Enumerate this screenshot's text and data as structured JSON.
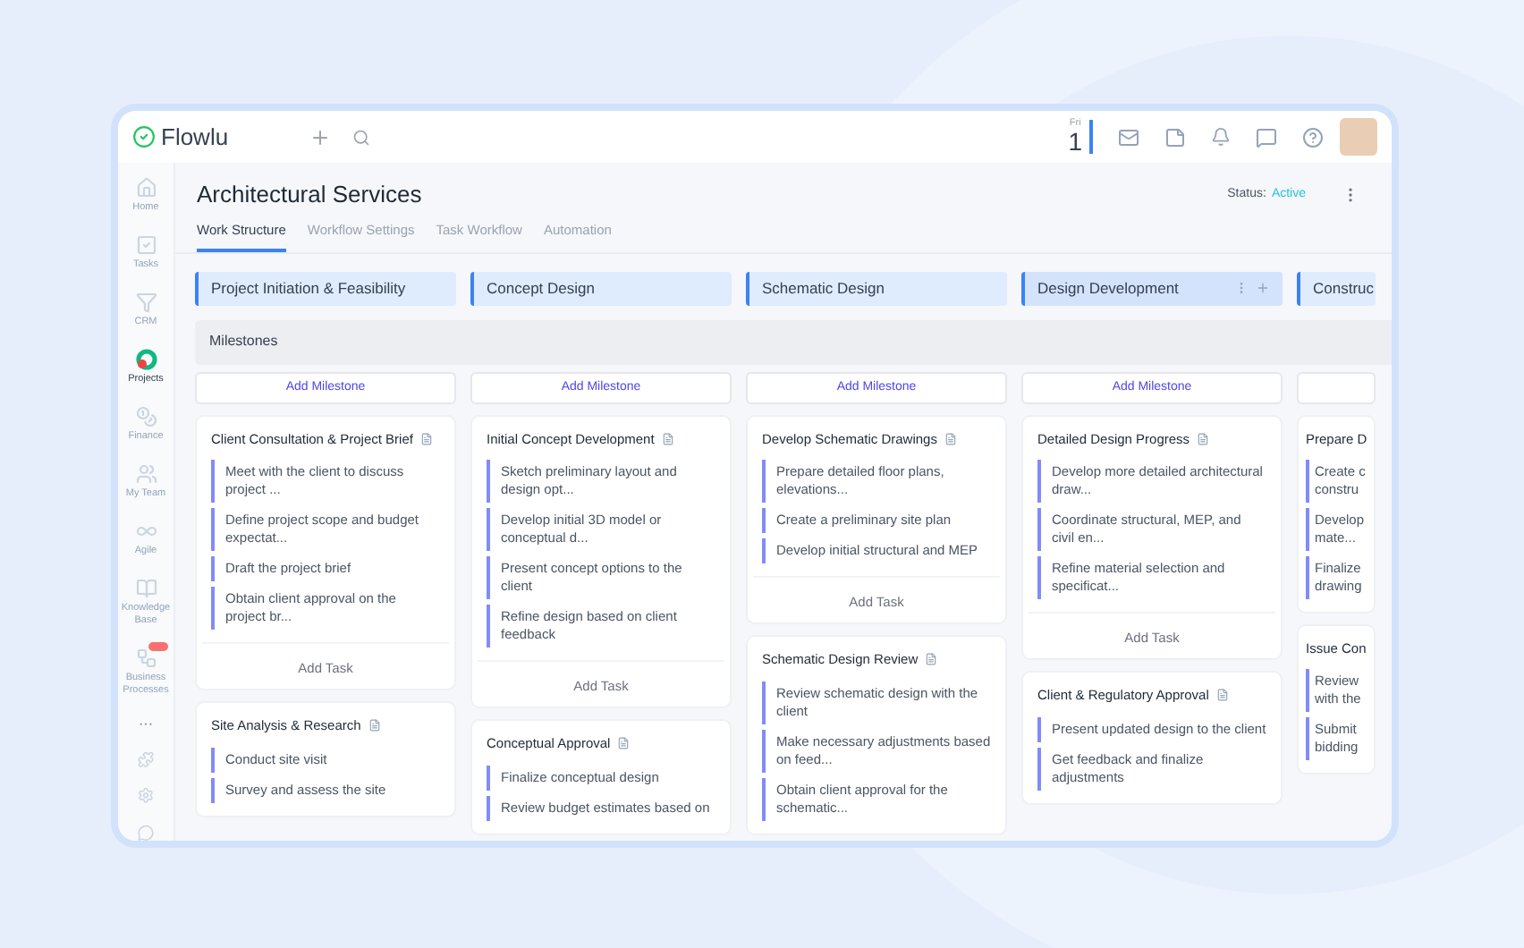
{
  "app": {
    "logo": "Flowlu"
  },
  "date": {
    "weekday": "Fri",
    "day": "1"
  },
  "sidebar": {
    "items": [
      {
        "label": "Home",
        "selected": false,
        "badge": false
      },
      {
        "label": "Tasks",
        "selected": false,
        "badge": false
      },
      {
        "label": "CRM",
        "selected": false,
        "badge": false
      },
      {
        "label": "Projects",
        "selected": true,
        "badge": false
      },
      {
        "label": "Finance",
        "selected": false,
        "badge": false
      },
      {
        "label": "My Team",
        "selected": false,
        "badge": false
      },
      {
        "label": "Agile",
        "selected": false,
        "badge": false
      },
      {
        "label": "Knowledge Base",
        "selected": false,
        "badge": false
      },
      {
        "label": "Business Processes",
        "selected": false,
        "badge": true
      }
    ],
    "more": "···"
  },
  "page": {
    "title": "Architectural Services",
    "status_label": "Status:",
    "status_value": "Active"
  },
  "tabs": [
    {
      "label": "Work Structure",
      "selected": true
    },
    {
      "label": "Workflow Settings",
      "selected": false
    },
    {
      "label": "Task Workflow",
      "selected": false
    },
    {
      "label": "Automation",
      "selected": false
    }
  ],
  "milestones_label": "Milestones",
  "columns": [
    {
      "title": "Project Initiation & Feasibility",
      "hovered": false,
      "add_milestone": "Add Milestone",
      "milestones": [
        {
          "title": "Client Consultation & Project Brief",
          "tasks": [
            "Meet with the client to discuss project ...",
            "Define project scope and budget expectat...",
            "Draft the project brief",
            "Obtain client approval on the project br..."
          ],
          "add_task": "Add Task"
        },
        {
          "title": "Site Analysis & Research",
          "tasks": [
            "Conduct site visit",
            "Survey and assess the site"
          ]
        }
      ]
    },
    {
      "title": "Concept Design",
      "hovered": false,
      "add_milestone": "Add Milestone",
      "milestones": [
        {
          "title": "Initial Concept Development",
          "tasks": [
            "Sketch preliminary layout and design opt...",
            "Develop initial 3D model or conceptual d...",
            "Present concept options to the client",
            "Refine design based on client feedback"
          ],
          "add_task": "Add Task"
        },
        {
          "title": "Conceptual Approval",
          "tasks": [
            "Finalize conceptual design",
            "Review budget estimates based on"
          ]
        }
      ]
    },
    {
      "title": "Schematic Design",
      "hovered": false,
      "add_milestone": "Add Milestone",
      "milestones": [
        {
          "title": "Develop Schematic Drawings",
          "tasks": [
            "Prepare detailed floor plans, elevations...",
            "Create a preliminary site plan",
            "Develop initial structural and MEP"
          ],
          "add_task": "Add Task"
        },
        {
          "title": "Schematic Design Review",
          "tasks": [
            "Review schematic design with the client",
            "Make necessary adjustments based on feed...",
            "Obtain client approval for the schematic..."
          ]
        }
      ]
    },
    {
      "title": "Design Development",
      "hovered": true,
      "add_milestone": "Add Milestone",
      "milestones": [
        {
          "title": "Detailed Design Progress",
          "tasks": [
            "Develop more detailed architectural draw...",
            "Coordinate structural, MEP, and civil en...",
            "Refine material selection and specificat..."
          ],
          "add_task": "Add Task"
        },
        {
          "title": "Client & Regulatory Approval",
          "tasks": [
            "Present updated design to the client",
            "Get feedback and finalize adjustments"
          ]
        }
      ]
    },
    {
      "title": "Construc",
      "hovered": false,
      "milestones": [
        {
          "title": "Prepare D",
          "tasks": [
            "Create c\nconstru",
            "Develop\nmate...",
            "Finalize\ndrawing"
          ]
        },
        {
          "title": "Issue Con",
          "tasks": [
            "Review\nwith the",
            "Submit\nbidding"
          ]
        }
      ]
    }
  ]
}
